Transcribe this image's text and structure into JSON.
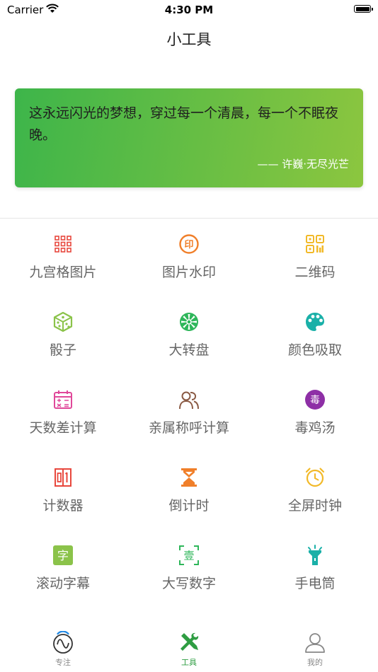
{
  "status_bar": {
    "carrier": "Carrier",
    "time": "4:30 PM"
  },
  "nav": {
    "title": "小工具"
  },
  "quote": {
    "text": "这永远闪光的梦想，穿过每一个清晨，每一个不眠夜晚。",
    "author": "—— 许巍·无尽光芒"
  },
  "tools": [
    {
      "label": "九宫格图片",
      "icon": "grid-nine-icon",
      "color": "#e8473d"
    },
    {
      "label": "图片水印",
      "icon": "stamp-icon",
      "color": "#f07f2a"
    },
    {
      "label": "二维码",
      "icon": "qr-code-icon",
      "color": "#f2b928"
    },
    {
      "label": "骰子",
      "icon": "dice-icon",
      "color": "#8bc34a"
    },
    {
      "label": "大转盘",
      "icon": "wheel-icon",
      "color": "#2eb65a"
    },
    {
      "label": "颜色吸取",
      "icon": "palette-icon",
      "color": "#1ab0a8"
    },
    {
      "label": "天数差计算",
      "icon": "calendar-icon",
      "color": "#e0489a"
    },
    {
      "label": "亲属称呼计算",
      "icon": "people-icon",
      "color": "#8a5a44"
    },
    {
      "label": "毒鸡汤",
      "icon": "poison-badge-icon",
      "color": "#8e2fa6",
      "glyph": "毒"
    },
    {
      "label": "计数器",
      "icon": "counter-icon",
      "color": "#e8473d"
    },
    {
      "label": "倒计时",
      "icon": "hourglass-icon",
      "color": "#f07f2a"
    },
    {
      "label": "全屏时钟",
      "icon": "alarm-clock-icon",
      "color": "#f2b928"
    },
    {
      "label": "滚动字幕",
      "icon": "caption-icon",
      "color": "#8bc34a",
      "glyph": "字"
    },
    {
      "label": "大写数字",
      "icon": "capital-number-icon",
      "color": "#2eb65a",
      "glyph": "壹"
    },
    {
      "label": "手电筒",
      "icon": "flashlight-icon",
      "color": "#1ab0a8"
    }
  ],
  "tabs": [
    {
      "label": "专注",
      "icon": "focus-icon",
      "active": false
    },
    {
      "label": "工具",
      "icon": "tools-icon",
      "active": true
    },
    {
      "label": "我的",
      "icon": "profile-icon",
      "active": false
    }
  ],
  "colors": {
    "accent": "#2e9d42",
    "gradient_start": "#3db54a",
    "gradient_end": "#8cc63f"
  }
}
